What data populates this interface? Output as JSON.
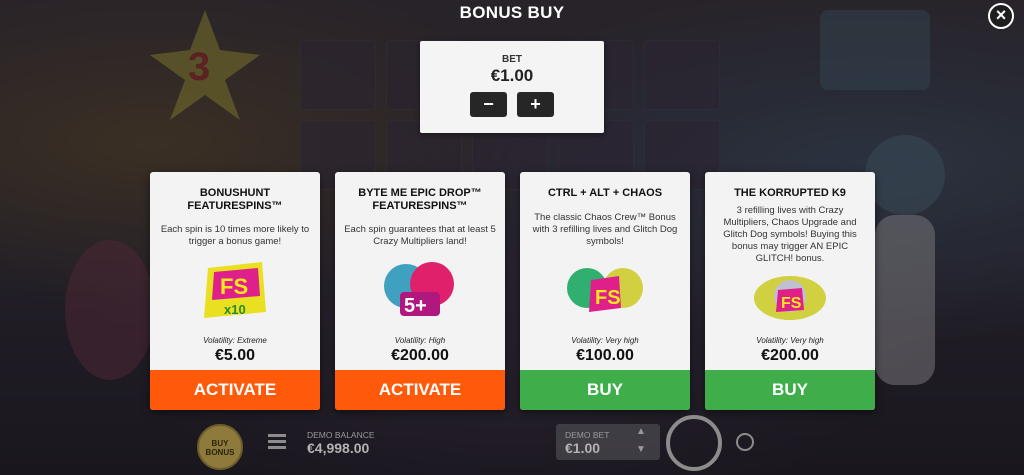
{
  "header": {
    "title": "BONUS BUY"
  },
  "bet": {
    "label": "BET",
    "value": "€1.00",
    "decrease_label": "−",
    "increase_label": "+"
  },
  "cards": [
    {
      "title": "BONUSHUNT FEATURESPINS™",
      "description": "Each spin is 10 times more likely to trigger a bonus game!",
      "icon_text": "FS",
      "icon_sub": "x10",
      "volatility": "Volatility: Extreme",
      "price": "€5.00",
      "action": "ACTIVATE"
    },
    {
      "title": "BYTE ME EPIC DROP™ FEATURESPINS™",
      "description": "Each spin guarantees that at least 5 Crazy Multipliers land!",
      "icon_text": "5+",
      "volatility": "Volatility: High",
      "price": "€200.00",
      "action": "ACTIVATE"
    },
    {
      "title": "CTRL + ALT + CHAOS",
      "description": "The classic Chaos Crew™ Bonus with 3 refilling lives and Glitch Dog symbols!",
      "icon_text": "FS",
      "volatility": "Volatility: Very high",
      "price": "€100.00",
      "action": "BUY"
    },
    {
      "title": "THE KORRUPTED K9",
      "description": "3 refilling lives with Crazy Multipliers, Chaos Upgrade and Glitch Dog symbols! Buying this bonus may trigger AN EPIC GLITCH! bonus.",
      "icon_text": "FS",
      "volatility": "Volatility: Very high",
      "price": "€200.00",
      "action": "BUY"
    }
  ],
  "bottom_bar": {
    "buy_bonus_label": "BUY BONUS",
    "balance_label": "DEMO BALANCE",
    "balance_value": "€4,998.00",
    "demo_bet_label": "DEMO BET",
    "demo_bet_value": "€1.00"
  },
  "colors": {
    "activate": "#ff5a0a",
    "buy": "#3fae4a",
    "panel": "#f3f3f3"
  }
}
